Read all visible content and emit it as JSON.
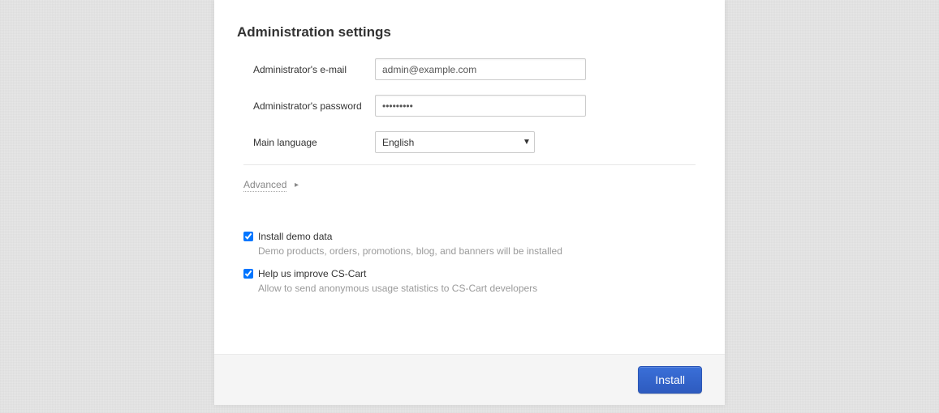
{
  "section_title": "Administration settings",
  "fields": {
    "email": {
      "label": "Administrator's e-mail",
      "value": "admin@example.com"
    },
    "password": {
      "label": "Administrator's password",
      "value": "•••••••••"
    },
    "language": {
      "label": "Main language",
      "value": "English"
    }
  },
  "advanced_label": "Advanced",
  "checks": {
    "demo": {
      "label": "Install demo data",
      "desc": "Demo products, orders, promotions, blog, and banners will be installed"
    },
    "improve": {
      "label": "Help us improve CS-Cart",
      "desc": "Allow to send anonymous usage statistics to CS-Cart developers"
    }
  },
  "install_label": "Install"
}
